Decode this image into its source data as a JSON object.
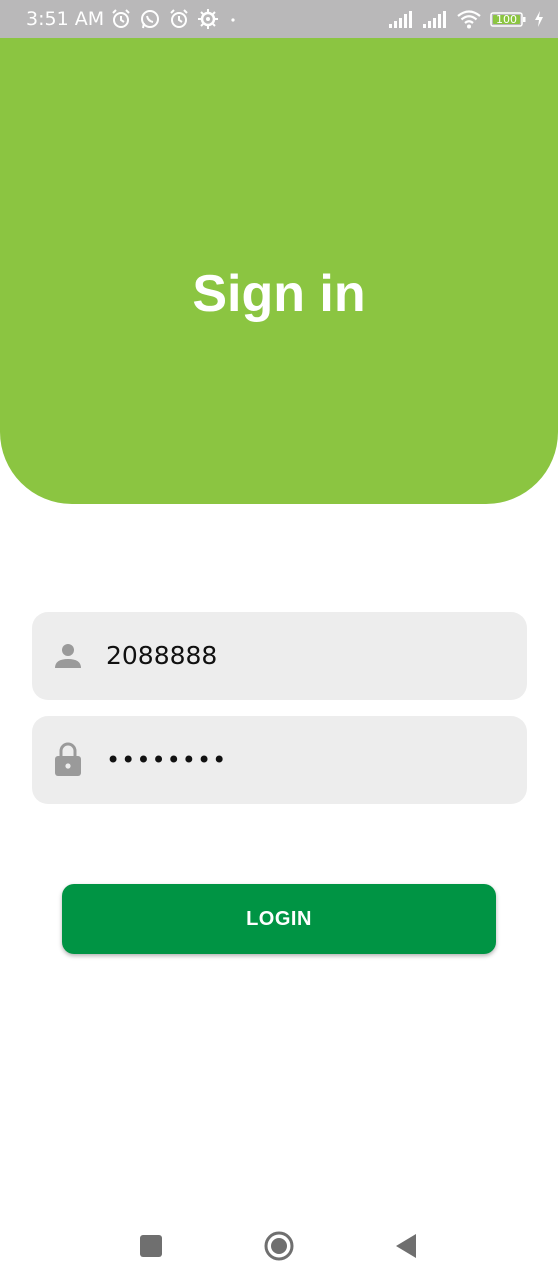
{
  "status_bar": {
    "time": "3:51 AM",
    "left_icons": [
      "alarm-icon",
      "whatsapp-icon",
      "alarm-icon",
      "settings-icon",
      "dot-icon"
    ],
    "right_icons": [
      "signal-icon",
      "signal-icon",
      "wifi-icon",
      "battery-icon",
      "charging-icon"
    ],
    "battery_level": "100"
  },
  "header": {
    "title": "Sign in",
    "background_color": "#8bc541"
  },
  "form": {
    "username": {
      "icon": "person-icon",
      "value": "2088888"
    },
    "password": {
      "icon": "lock-icon",
      "value": "••••••••"
    },
    "login_label": "LOGIN",
    "login_color": "#009444"
  },
  "nav_bar": {
    "buttons": [
      "recents-button",
      "home-button",
      "back-button"
    ]
  }
}
